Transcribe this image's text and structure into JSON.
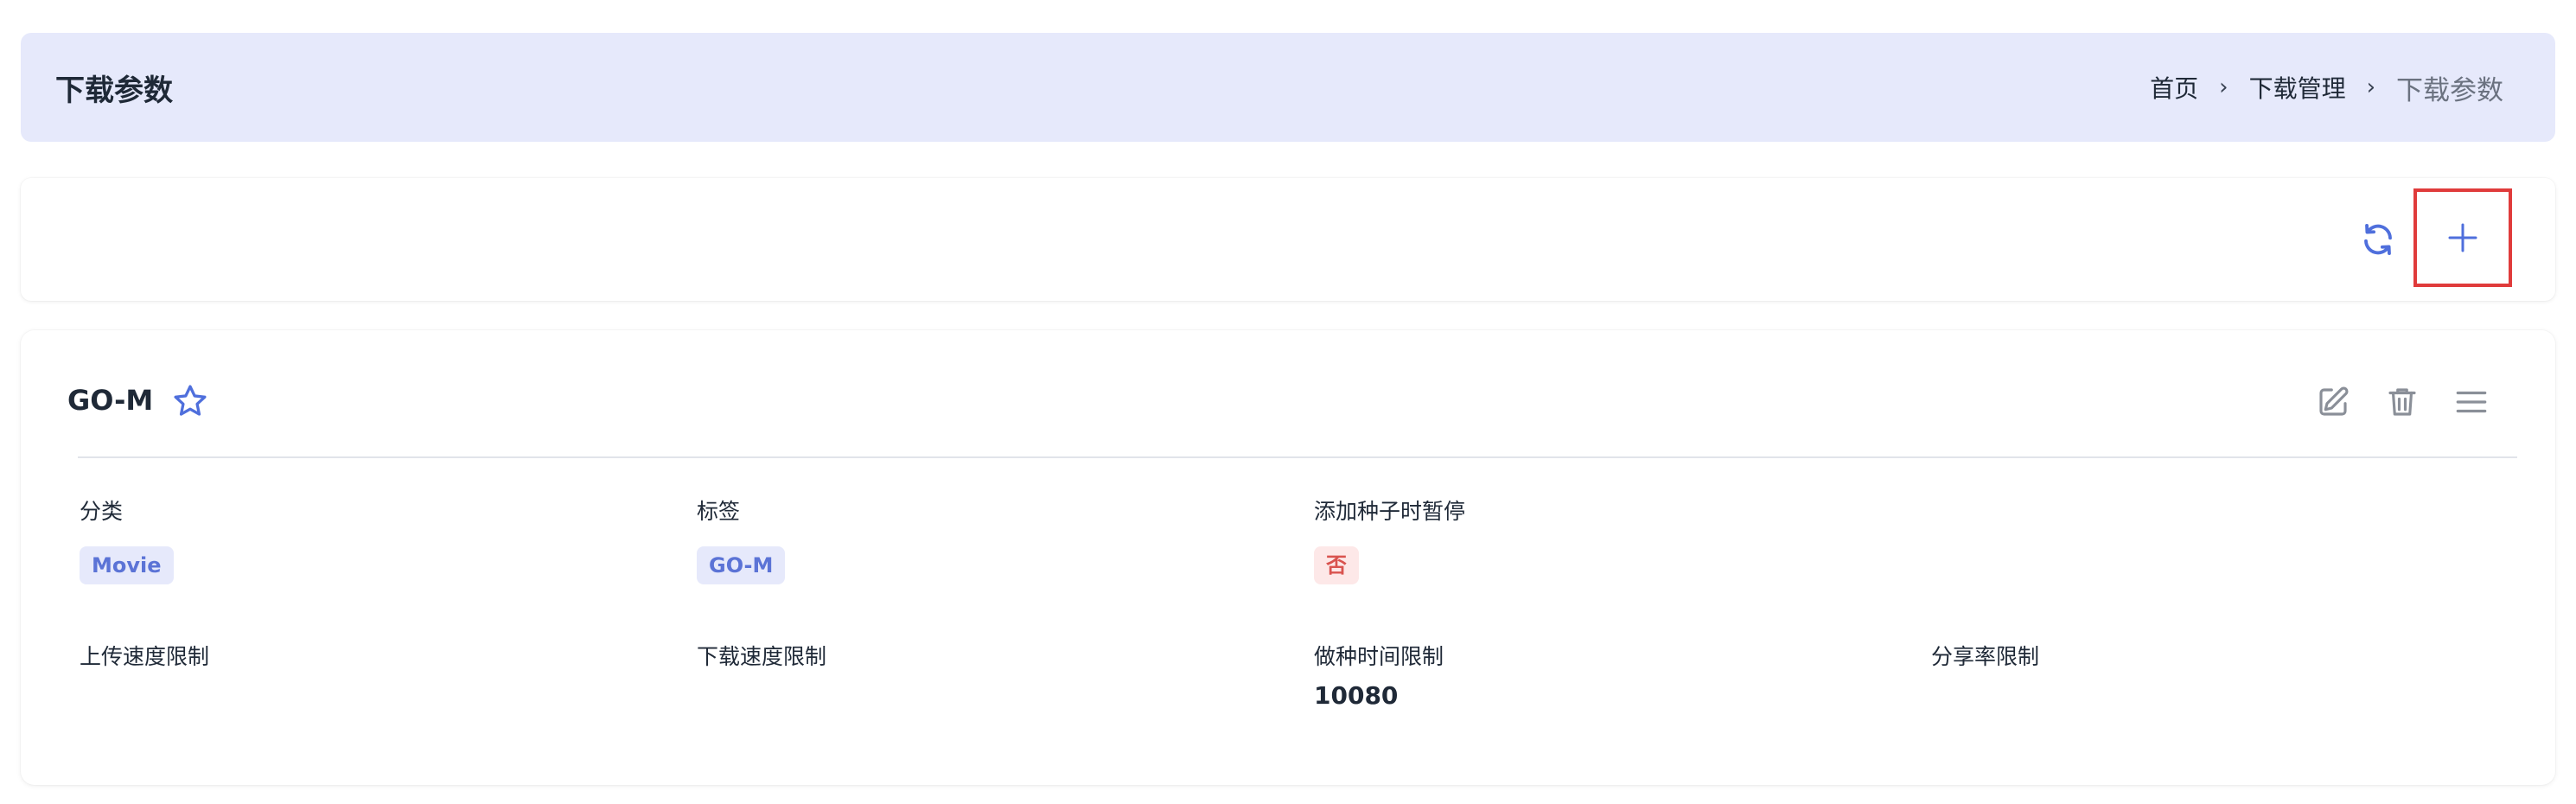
{
  "header": {
    "title": "下载参数",
    "breadcrumb": [
      "首页",
      "下载管理",
      "下载参数"
    ]
  },
  "toolbar": {
    "refresh_icon": "refresh-icon",
    "add_icon": "plus-icon",
    "accent_color": "#4f6fdc",
    "highlight_color": "#e03b3b"
  },
  "card": {
    "title": "GO-M",
    "favorite_icon": "star-icon",
    "actions": [
      "edit-icon",
      "delete-icon",
      "menu-icon"
    ],
    "fields": {
      "category": {
        "label": "分类",
        "value": "Movie"
      },
      "tags": {
        "label": "标签",
        "value": "GO-M"
      },
      "pause_on_add": {
        "label": "添加种子时暂停",
        "value": "否"
      },
      "upload_limit": {
        "label": "上传速度限制",
        "value": ""
      },
      "download_limit": {
        "label": "下载速度限制",
        "value": ""
      },
      "seeding_time_limit": {
        "label": "做种时间限制",
        "value": "10080"
      },
      "ratio_limit": {
        "label": "分享率限制",
        "value": ""
      }
    }
  }
}
